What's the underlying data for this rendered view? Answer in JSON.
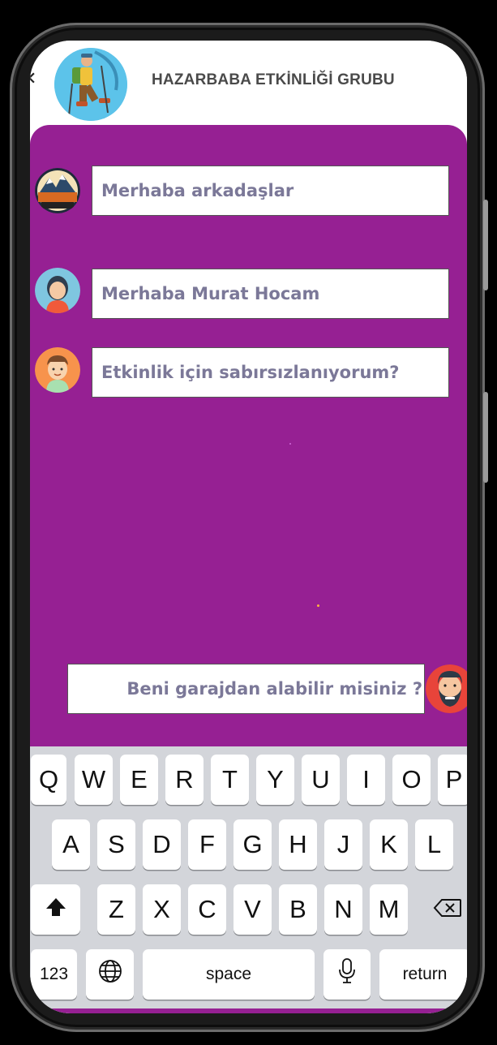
{
  "header": {
    "title": "HAZARBABA ETKİNLİĞİ GRUBU",
    "back_icon": "close-icon",
    "avatar_icon": "hiker-avatar"
  },
  "messages": [
    {
      "text": "Merhaba arkadaşlar",
      "sender_icon": "nature-club-logo",
      "side": "left"
    },
    {
      "text": "Merhaba Murat Hocam",
      "sender_icon": "woman-avatar",
      "side": "left"
    },
    {
      "text": "Etkinlik için sabırsızlanıyorum?",
      "sender_icon": "boy-avatar",
      "side": "left"
    },
    {
      "text": "Beni garajdan alabilir misiniz ?",
      "sender_icon": "bearded-man-avatar",
      "side": "right"
    }
  ],
  "keyboard": {
    "row1": [
      "Q",
      "W",
      "E",
      "R",
      "T",
      "Y",
      "U",
      "I",
      "O",
      "P"
    ],
    "row2": [
      "A",
      "S",
      "D",
      "F",
      "G",
      "H",
      "J",
      "K",
      "L"
    ],
    "row3": [
      "Z",
      "X",
      "C",
      "V",
      "B",
      "N",
      "M"
    ],
    "numbers_label": "123",
    "space_label": "space",
    "return_label": "return"
  },
  "colors": {
    "chat_background": "#962093",
    "bubble_text": "#7b7898",
    "keyboard_background": "#d3d5da"
  }
}
